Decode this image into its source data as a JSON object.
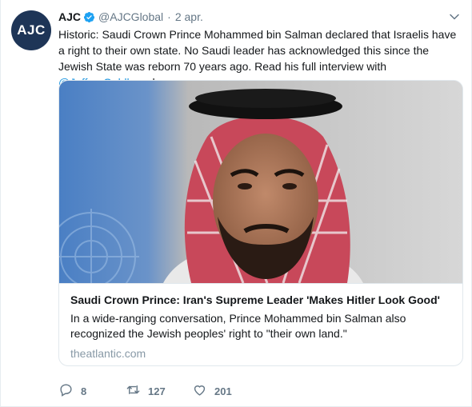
{
  "author": {
    "avatar_text": "AJC",
    "name": "AJC",
    "handle": "@AJCGlobal",
    "separator": "·",
    "date": "2 apr."
  },
  "tweet": {
    "text_before_mention": "Historic: Saudi Crown Prince Mohammed bin Salman declared that Israelis have a right to their own state. No Saudi leader has acknowledged this since the Jewish State was reborn 70 years ago. Read his full interview with ",
    "mention": "@JeffreyGoldberg",
    "text_after_mention": " here."
  },
  "card": {
    "title": "Saudi Crown Prince: Iran's Supreme Leader 'Makes Hitler Look Good'",
    "description": "In a wide-ranging conversation, Prince Mohammed bin Salman also recognized the Jewish peoples' right to \"their own land.\"",
    "domain": "theatlantic.com"
  },
  "actions": {
    "replies": "8",
    "retweets": "127",
    "likes": "201"
  },
  "colors": {
    "avatar_bg": "#1e3557",
    "link": "#1b95e0",
    "verified": "#1da1f2",
    "muted": "#657786"
  },
  "icons": [
    "verified-badge-icon",
    "chevron-down-icon",
    "reply-icon",
    "retweet-icon",
    "like-icon"
  ]
}
